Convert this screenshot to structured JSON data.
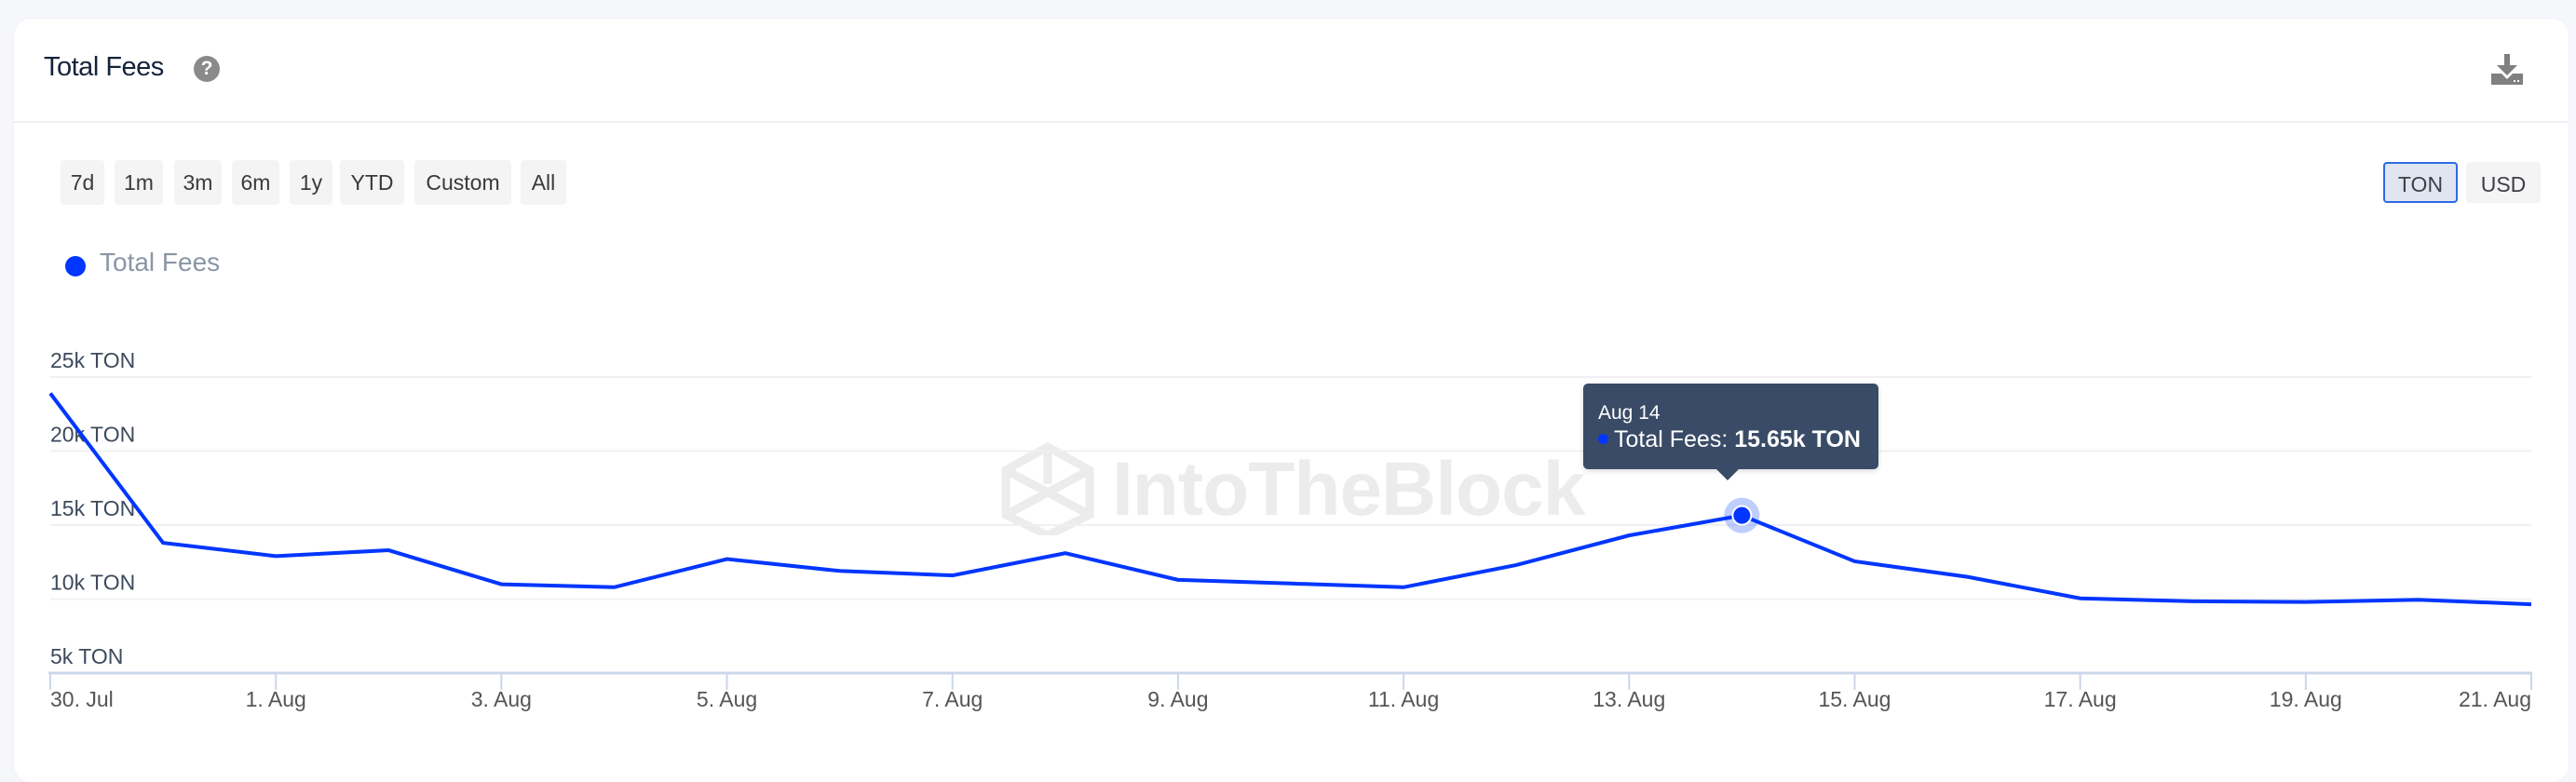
{
  "card": {
    "title": "Total Fees",
    "help_icon": "question-circle-icon",
    "download_icon": "download-icon"
  },
  "range_buttons": [
    {
      "label": "7d"
    },
    {
      "label": "1m"
    },
    {
      "label": "3m"
    },
    {
      "label": "6m"
    },
    {
      "label": "1y"
    },
    {
      "label": "YTD"
    },
    {
      "label": "Custom"
    },
    {
      "label": "All"
    }
  ],
  "currency_toggle": {
    "options": [
      {
        "label": "TON",
        "active": true
      },
      {
        "label": "USD",
        "active": false
      }
    ]
  },
  "colors": {
    "series": "#0036ff",
    "tooltip_bg": "#394b66",
    "active_toggle_border": "#2d6be4"
  },
  "tooltip": {
    "date": "Aug 14",
    "series_label": "Total Fees: ",
    "value": "15.65k TON"
  },
  "watermark": {
    "text": "IntoTheBlock"
  },
  "chart_data": {
    "type": "line",
    "title": "Total Fees",
    "xlabel": "",
    "ylabel": "",
    "unit": "TON",
    "legend": [
      {
        "name": "Total Fees",
        "color": "#0036ff"
      }
    ],
    "legend_position": "top-left",
    "grid": true,
    "ylim": [
      5000,
      25000
    ],
    "y_ticks": [
      {
        "value": 5000,
        "label": "5k TON"
      },
      {
        "value": 10000,
        "label": "10k TON"
      },
      {
        "value": 15000,
        "label": "15k TON"
      },
      {
        "value": 20000,
        "label": "20k TON"
      },
      {
        "value": 25000,
        "label": "25k TON"
      }
    ],
    "x_ticks": [
      {
        "day": 0,
        "label": "30. Jul"
      },
      {
        "day": 2,
        "label": "1. Aug"
      },
      {
        "day": 4,
        "label": "3. Aug"
      },
      {
        "day": 6,
        "label": "5. Aug"
      },
      {
        "day": 8,
        "label": "7. Aug"
      },
      {
        "day": 10,
        "label": "9. Aug"
      },
      {
        "day": 12,
        "label": "11. Aug"
      },
      {
        "day": 14,
        "label": "13. Aug"
      },
      {
        "day": 16,
        "label": "15. Aug"
      },
      {
        "day": 18,
        "label": "17. Aug"
      },
      {
        "day": 20,
        "label": "19. Aug"
      },
      {
        "day": 22,
        "label": "21. Aug"
      }
    ],
    "x_range_days": [
      0,
      22
    ],
    "highlighted_point": {
      "date": "Aug 14",
      "day": 15,
      "value": 15650
    },
    "series": [
      {
        "name": "Total Fees",
        "x": [
          "Jul 30",
          "Jul 31",
          "Aug 1",
          "Aug 2",
          "Aug 3",
          "Aug 4",
          "Aug 5",
          "Aug 6",
          "Aug 7",
          "Aug 8",
          "Aug 9",
          "Aug 10",
          "Aug 11",
          "Aug 12",
          "Aug 13",
          "Aug 14",
          "Aug 15",
          "Aug 16",
          "Aug 17",
          "Aug 18",
          "Aug 19",
          "Aug 20",
          "Aug 21"
        ],
        "values": [
          23900,
          13800,
          12900,
          13300,
          11000,
          10800,
          12700,
          11900,
          11600,
          13100,
          11300,
          11050,
          10800,
          12300,
          14300,
          15650,
          12550,
          11500,
          10050,
          9850,
          9800,
          9950,
          9650
        ]
      }
    ]
  }
}
